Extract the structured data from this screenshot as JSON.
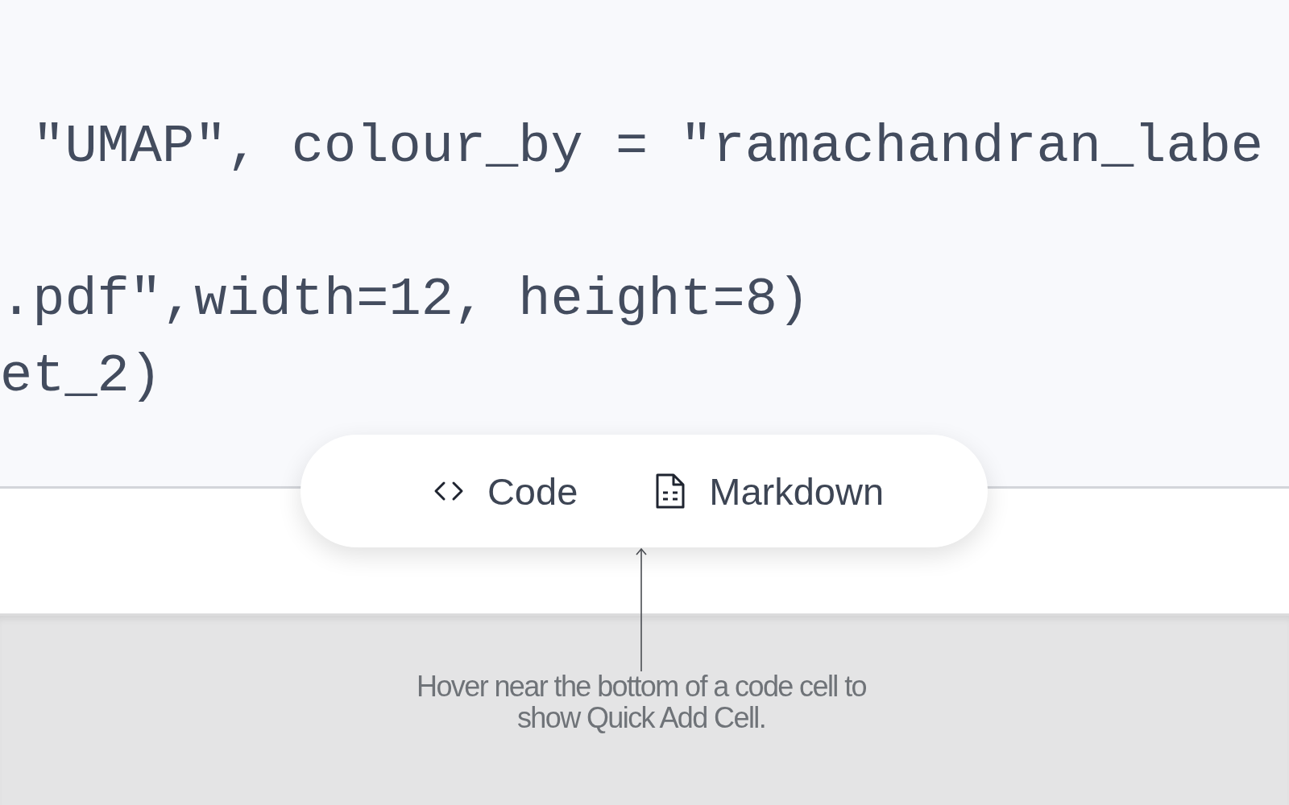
{
  "code_lines": [
    " \"UMAP\", colour_by = \"ramachandran_labe",
    ".pdf\",width=12, height=8)",
    "et_2)"
  ],
  "quick_add": {
    "buttons": [
      {
        "kind": "code",
        "label": "Code"
      },
      {
        "kind": "markdown",
        "label": "Markdown"
      }
    ]
  },
  "annotation": {
    "text": "Hover near the bottom of a code cell to show Quick Add Cell."
  }
}
